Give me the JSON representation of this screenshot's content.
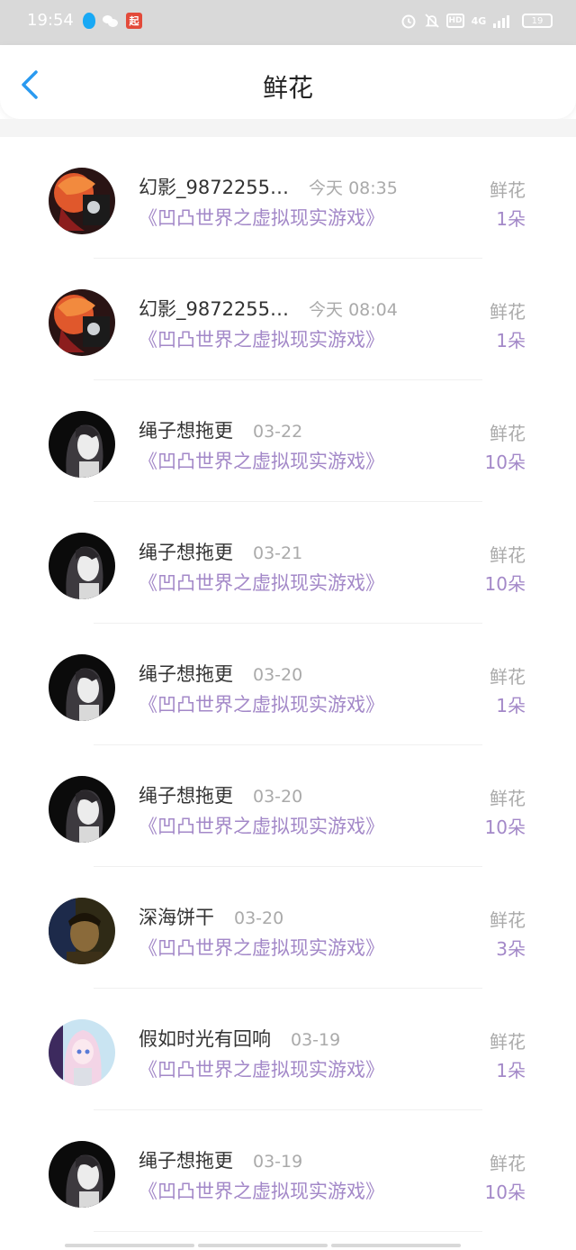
{
  "status_bar": {
    "time": "19:54",
    "network": "4G",
    "battery": "19",
    "hd": "HD",
    "app_badge": "起"
  },
  "header": {
    "title": "鲜花",
    "back_icon": "chevron-left-icon"
  },
  "items": [
    {
      "username": "幻影_9872255…",
      "time": "今天 08:35",
      "book": "《凹凸世界之虚拟现实游戏》",
      "gift_label": "鲜花",
      "count": "1朵",
      "avatar_style": "red-anime"
    },
    {
      "username": "幻影_9872255…",
      "time": "今天 08:04",
      "book": "《凹凸世界之虚拟现实游戏》",
      "gift_label": "鲜花",
      "count": "1朵",
      "avatar_style": "red-anime"
    },
    {
      "username": "绳子想拖更",
      "time": "03-22",
      "book": "《凹凸世界之虚拟现实游戏》",
      "gift_label": "鲜花",
      "count": "10朵",
      "avatar_style": "dark-girl"
    },
    {
      "username": "绳子想拖更",
      "time": "03-21",
      "book": "《凹凸世界之虚拟现实游戏》",
      "gift_label": "鲜花",
      "count": "10朵",
      "avatar_style": "dark-girl"
    },
    {
      "username": "绳子想拖更",
      "time": "03-20",
      "book": "《凹凸世界之虚拟现实游戏》",
      "gift_label": "鲜花",
      "count": "1朵",
      "avatar_style": "dark-girl"
    },
    {
      "username": "绳子想拖更",
      "time": "03-20",
      "book": "《凹凸世界之虚拟现实游戏》",
      "gift_label": "鲜花",
      "count": "10朵",
      "avatar_style": "dark-girl"
    },
    {
      "username": "深海饼干",
      "time": "03-20",
      "book": "《凹凸世界之虚拟现实游戏》",
      "gift_label": "鲜花",
      "count": "3朵",
      "avatar_style": "photo-boy"
    },
    {
      "username": "假如时光有回响",
      "time": "03-19",
      "book": "《凹凸世界之虚拟现实游戏》",
      "gift_label": "鲜花",
      "count": "1朵",
      "avatar_style": "pink-anime"
    },
    {
      "username": "绳子想拖更",
      "time": "03-19",
      "book": "《凹凸世界之虚拟现实游戏》",
      "gift_label": "鲜花",
      "count": "10朵",
      "avatar_style": "dark-girl"
    }
  ],
  "colors": {
    "accent_purple": "#a388c8",
    "back_blue": "#2a9af0",
    "muted_gray": "#aaaaaa"
  }
}
